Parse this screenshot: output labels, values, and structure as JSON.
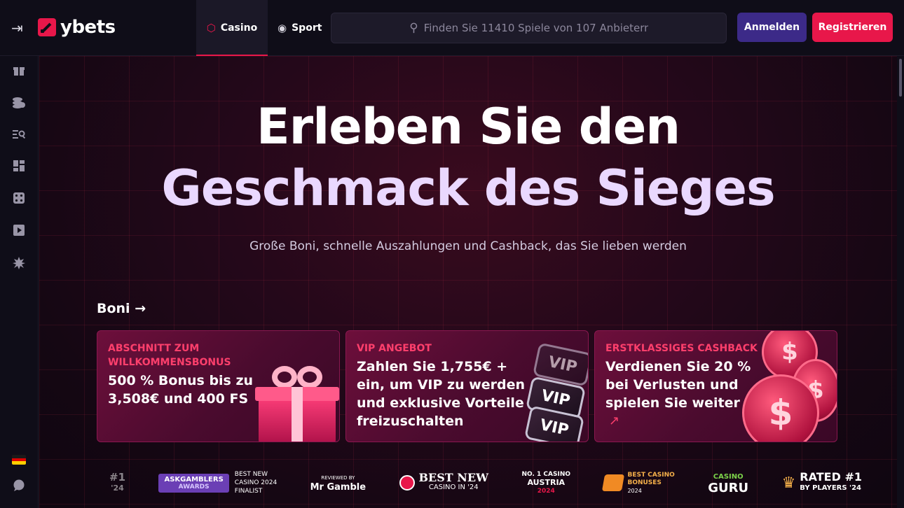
{
  "header": {
    "logo_text": "ybets",
    "tabs": [
      {
        "label": "Casino",
        "icon": "casino-icon",
        "active": true
      },
      {
        "label": "Sport",
        "icon": "ball-icon",
        "active": false
      }
    ],
    "search_placeholder": "Finden Sie 11410 Spiele von 107 Anbietern",
    "login_label": "Anmelden",
    "register_label": "Registrieren"
  },
  "sidebar": {
    "icons": [
      "gift-icon",
      "coins-icon",
      "list-search-icon",
      "grid-icon",
      "dice-icon",
      "play-icon",
      "burst-icon"
    ],
    "language": "de",
    "chat_icon": "chat-icon"
  },
  "hero": {
    "title_line1": "Erleben Sie den",
    "title_line2": "Geschmack des Sieges",
    "subtitle": "Große Boni, schnelle Auszahlungen und Cashback, das Sie lieben werden"
  },
  "bonuses": {
    "section_label": "Boni",
    "cards": [
      {
        "category": "ABSCHNITT ZUM WILLKOMMENSBONUS",
        "description": "500 % Bonus bis zu 3,508€ und 400 FS"
      },
      {
        "category": "VIP ANGEBOT",
        "description": "Zahlen Sie 1,755€ + ein, um VIP zu werden und exklusive Vorteile freizuschalten",
        "badge": "VIP"
      },
      {
        "category": "ERSTKLASSIGES CASHBACK",
        "description": "Verdienen Sie 20 % bei Verlusten und spielen Sie weiter"
      }
    ]
  },
  "awards": {
    "partial_left": "#1",
    "partial_left_sub": "'24",
    "askgamblers": {
      "brand": "ASKGAMBLERS",
      "sub": "AWARDS",
      "line1": "BEST NEW",
      "line2": "CASINO 2024",
      "line3": "FINALIST"
    },
    "mrgamble": {
      "top": "REVIEWED BY",
      "name": "Mr Gamble"
    },
    "bestnew": {
      "line1": "BEST NEW",
      "line2": "CASINO IN '24"
    },
    "austria": {
      "line1": "NO. 1 CASINO",
      "line2": "AUSTRIA",
      "line3": "2024"
    },
    "bestbonuses": {
      "line1": "BEST CASINO",
      "line2": "BONUSES",
      "line3": "2024"
    },
    "casinoguru": {
      "line1": "CASINO",
      "line2": "GURU"
    },
    "rated": {
      "line1": "RATED #1",
      "line2": "BY PLAYERS '24"
    }
  },
  "colors": {
    "accent": "#e8174a",
    "login": "#3c2a88",
    "bg": "#0f0d18"
  }
}
